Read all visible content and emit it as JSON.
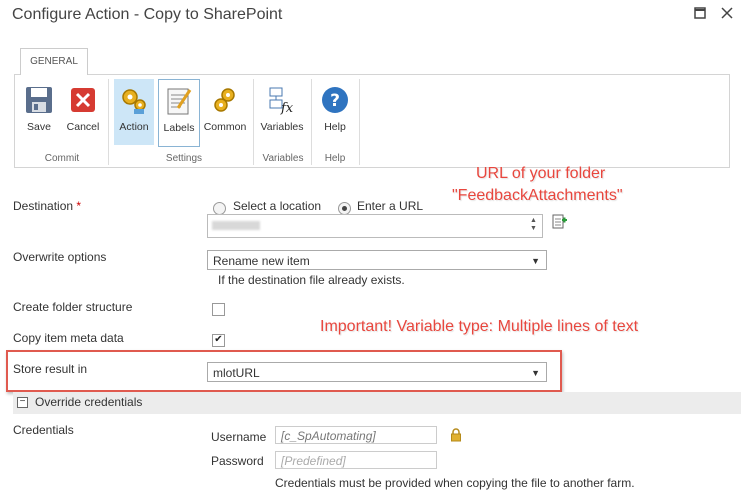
{
  "window": {
    "title": "Configure Action - Copy to SharePoint"
  },
  "ribbon": {
    "tab": "GENERAL",
    "buttons": {
      "save": "Save",
      "cancel": "Cancel",
      "action": "Action",
      "labels": "Labels",
      "common": "Common",
      "variables": "Variables",
      "help": "Help"
    },
    "groups": {
      "commit": "Commit",
      "settings": "Settings",
      "variables": "Variables",
      "help": "Help"
    }
  },
  "form": {
    "destination": {
      "label": "Destination",
      "required": "*",
      "option_select": "Select a location",
      "option_url": "Enter a URL",
      "selected": "Enter a URL"
    },
    "overwrite": {
      "label": "Overwrite options",
      "value": "Rename new item",
      "hint": "If the destination file already exists."
    },
    "create_folder": {
      "label": "Create folder structure",
      "checked": false
    },
    "copy_meta": {
      "label": "Copy item meta data",
      "checked": true
    },
    "store_result": {
      "label": "Store result in",
      "value": "mlotURL"
    },
    "override_credentials": {
      "label": "Override credentials",
      "toggle": "−"
    },
    "credentials": {
      "label": "Credentials",
      "username_label": "Username",
      "username_value": "[c_SpAutomating]",
      "password_label": "Password",
      "password_placeholder": "[Predefined]",
      "note": "Credentials must be provided when copying the file to another farm."
    }
  },
  "annotations": {
    "url_line1": "URL of your folder",
    "url_line2": "\"FeedbackAttachments\"",
    "important": "Important! Variable type: Multiple lines of text"
  },
  "colors": {
    "annotation": "#e8463d",
    "active_button": "#cde6f7",
    "required": "#cc0000"
  }
}
